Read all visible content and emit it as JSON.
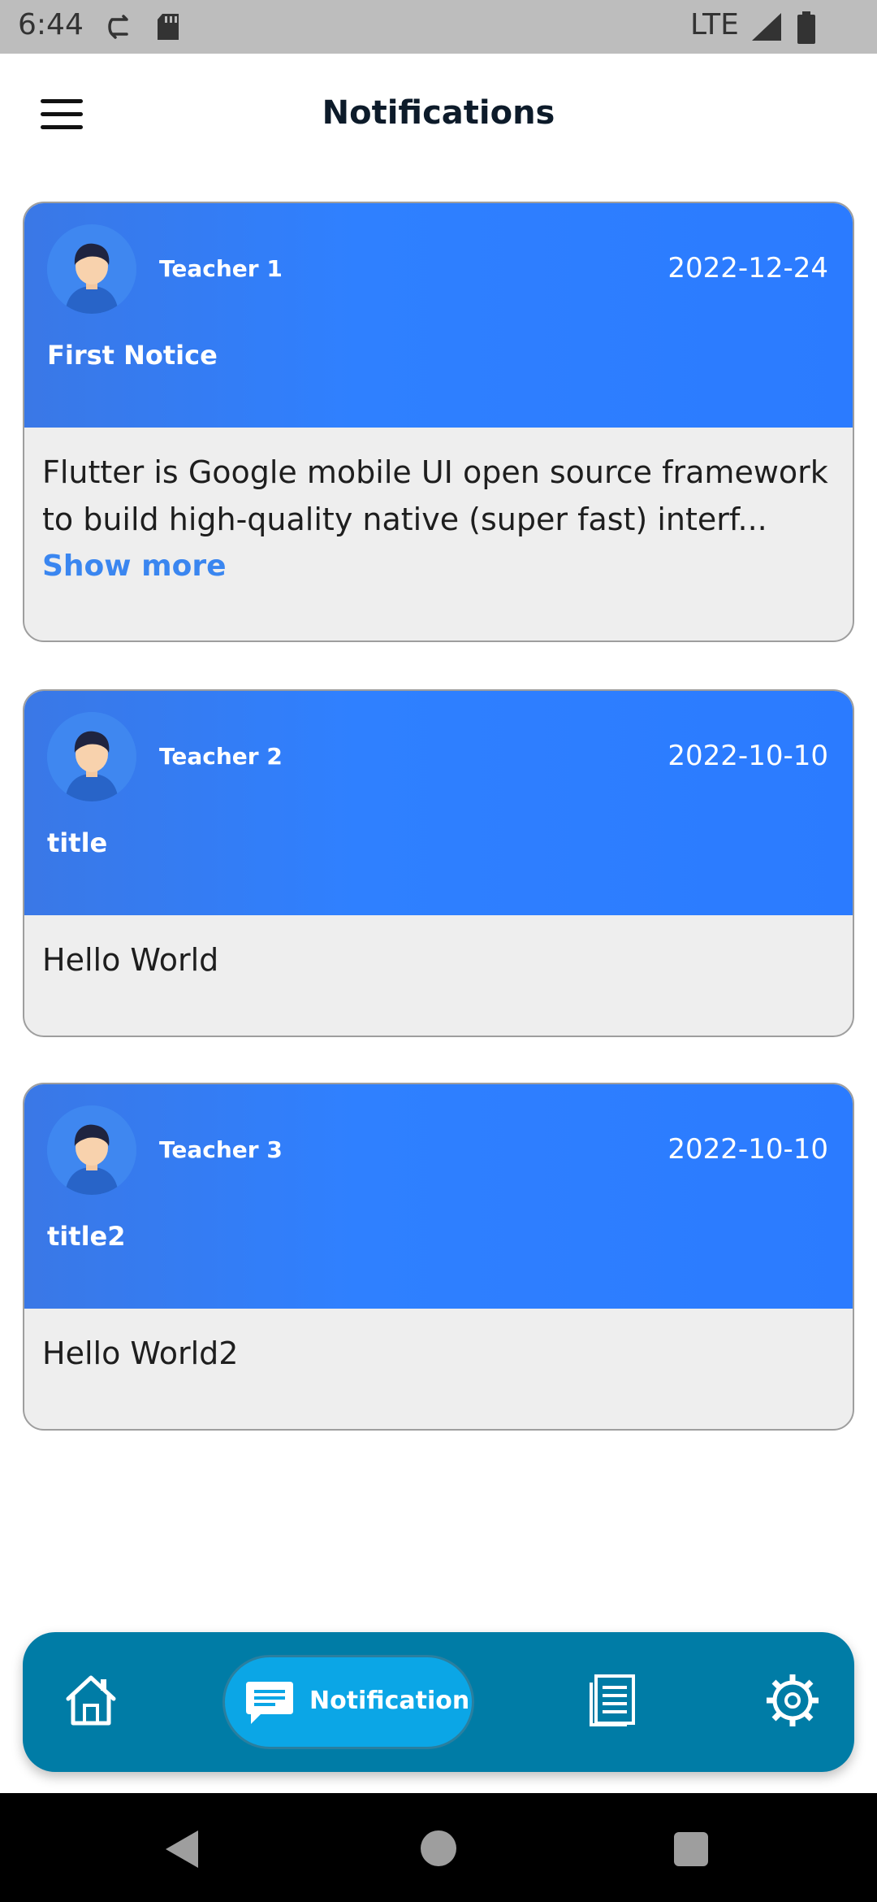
{
  "status_bar": {
    "time": "6:44",
    "network": "LTE",
    "icons": [
      "sync-icon",
      "sd-card-icon",
      "signal-icon",
      "battery-icon"
    ]
  },
  "app_bar": {
    "title": "Notifications",
    "menu_icon": "hamburger-menu-icon"
  },
  "notifications": [
    {
      "teacher": "Teacher 1",
      "date": "2022-12-24",
      "title": "First Notice",
      "body": "Flutter is Google mobile UI open source framework to build high-quality native (super fast) interf...",
      "show_more": "Show more"
    },
    {
      "teacher": "Teacher 2",
      "date": "2022-10-10",
      "title": "title",
      "body": "Hello World"
    },
    {
      "teacher": "Teacher 3",
      "date": "2022-10-10",
      "title": "title2",
      "body": "Hello World2"
    }
  ],
  "bottom_nav": {
    "items": [
      {
        "icon": "home-icon",
        "active": false
      },
      {
        "icon": "chat-icon",
        "label": "Notification",
        "active": true
      },
      {
        "icon": "notes-icon",
        "active": false
      },
      {
        "icon": "settings-icon",
        "active": false
      }
    ]
  },
  "colors": {
    "card_header": "#2f80ff",
    "card_body": "#eeeeee",
    "bottom_nav": "#007ca6",
    "active_pill": "#0ba6e6",
    "link": "#3a86f0"
  }
}
